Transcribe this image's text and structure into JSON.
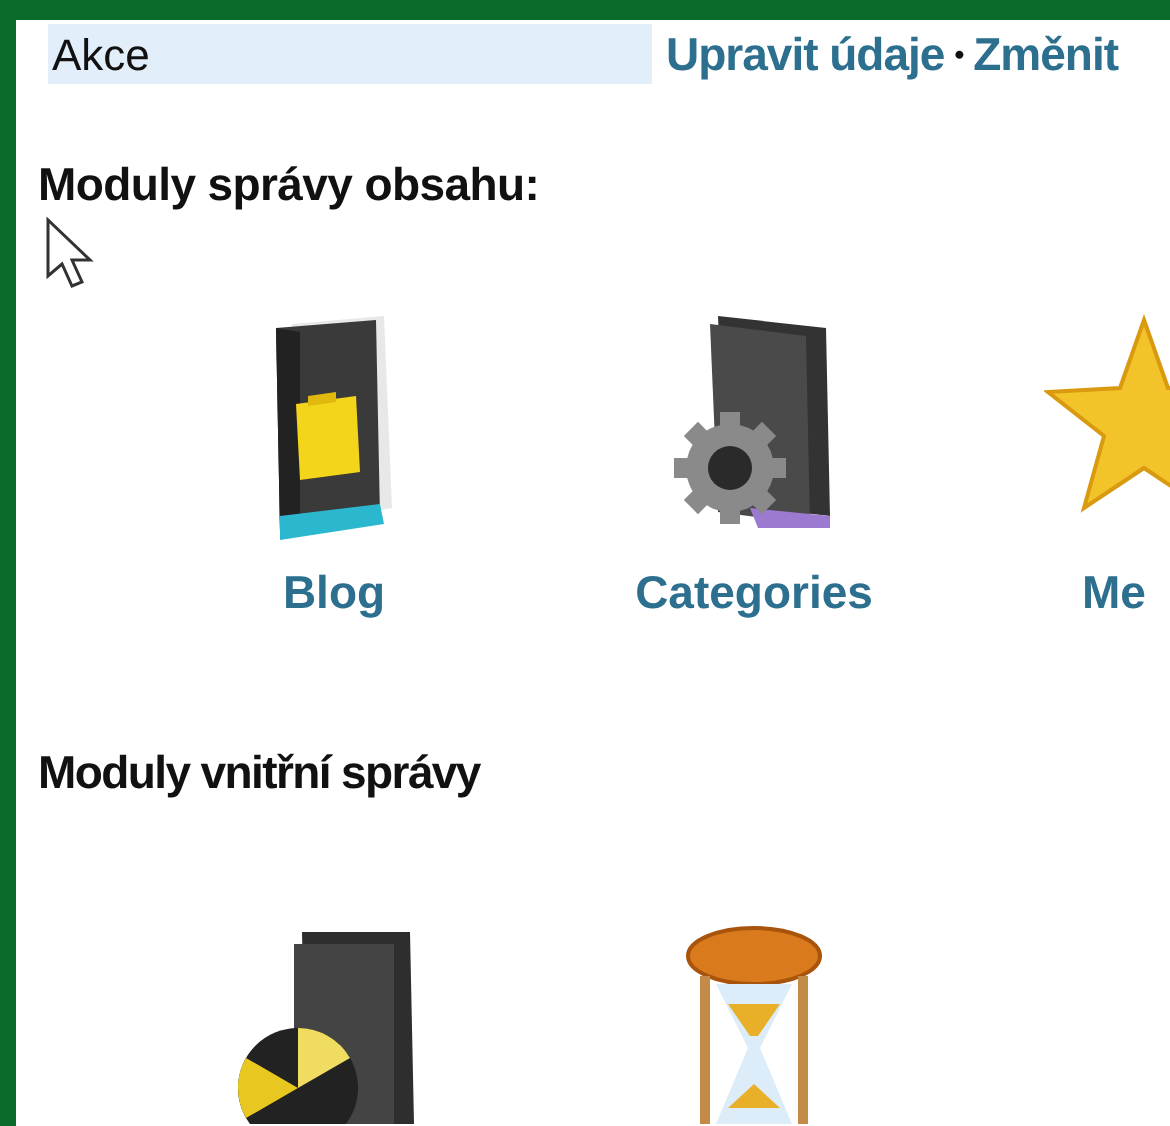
{
  "top_bar": {
    "field_text": "Akce",
    "links": [
      "Upravit údaje",
      "Změnit"
    ],
    "separator": "•"
  },
  "sections": [
    {
      "title": "Moduly správy obsahu:",
      "pointer": true,
      "modules": [
        {
          "kind": "folder-note",
          "label": "Blog"
        },
        {
          "kind": "folder-gear",
          "label": "Categories"
        },
        {
          "kind": "star",
          "label": "Me"
        }
      ]
    },
    {
      "title": "Moduly vnitřní správy",
      "pointer": false,
      "modules": [
        {
          "kind": "folder-disc"
        },
        {
          "kind": "hourglass"
        }
      ]
    }
  ]
}
